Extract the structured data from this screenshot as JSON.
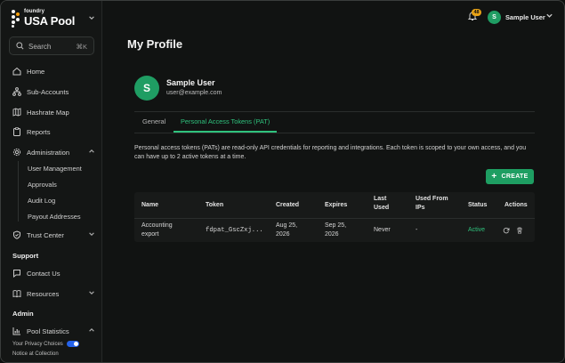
{
  "brand": {
    "small": "foundry",
    "name": "USA Pool"
  },
  "search": {
    "label": "Search",
    "shortcut": "⌘K"
  },
  "nav": {
    "home": "Home",
    "sub_accounts": "Sub-Accounts",
    "hashrate_map": "Hashrate Map",
    "reports": "Reports",
    "administration": "Administration",
    "admin_items": [
      "User Management",
      "Approvals",
      "Audit Log",
      "Payout Addresses"
    ],
    "trust_center": "Trust Center",
    "support_heading": "Support",
    "contact_us": "Contact Us",
    "resources": "Resources",
    "admin_heading": "Admin",
    "pool_statistics": "Pool Statistics"
  },
  "footer": {
    "privacy": "Your Privacy Choices",
    "notice": "Notice at Collection"
  },
  "header": {
    "notification_count": "48",
    "user_initial": "S",
    "user_name": "Sample User"
  },
  "profile": {
    "page_title": "My Profile",
    "initial": "S",
    "name": "Sample User",
    "email": "user@example.com",
    "tabs": [
      "General",
      "Personal Access Tokens (PAT)"
    ],
    "active_tab": "Personal Access Tokens (PAT)",
    "description": "Personal access tokens (PATs) are read-only API credentials for reporting and integrations. Each token is scoped to your own access, and you can have up to 2 active tokens at a time.",
    "create_label": "CREATE"
  },
  "tokens": {
    "headers": {
      "name": "Name",
      "token": "Token",
      "created": "Created",
      "expires": "Expires",
      "last_used": "Last Used",
      "used_from": "Used From IPs",
      "status": "Status",
      "actions": "Actions"
    },
    "rows": [
      {
        "name": "Accounting export",
        "token": "fdpat_GscZxj...",
        "created": "Aug 25, 2026",
        "expires": "Sep 25, 2026",
        "last_used": "Never",
        "used_from": "-",
        "status": "Active"
      }
    ]
  },
  "colors": {
    "accent": "#2fc27d",
    "button": "#1e9e62",
    "badge": "#e8a317",
    "background": "#111312"
  }
}
